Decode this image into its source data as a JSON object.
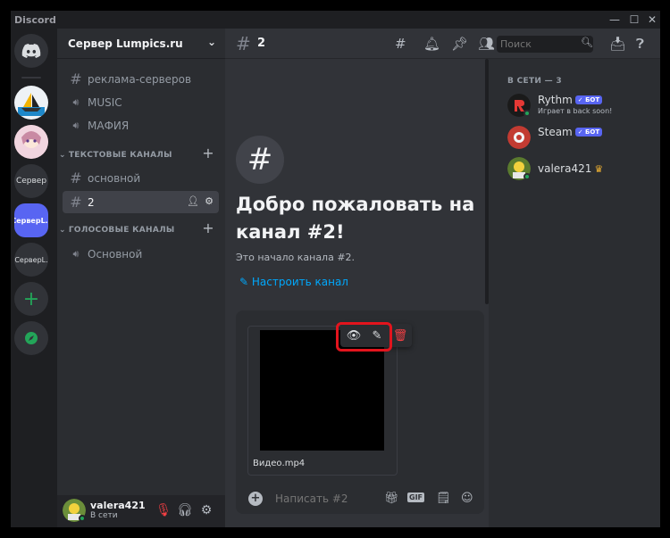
{
  "app": {
    "title": "Discord"
  },
  "window_controls": {
    "minimize": "—",
    "maximize": "☐",
    "close": "✕"
  },
  "servers": [
    {
      "label": "",
      "name": "discord-home"
    },
    {
      "label": "",
      "name": "boat-server"
    },
    {
      "label": "",
      "name": "anime-server"
    },
    {
      "label": "Сервер",
      "name": "server-plain"
    },
    {
      "label": "СерверL.r",
      "name": "server-lumpics-active"
    },
    {
      "label": "СерверL.",
      "name": "server-l"
    },
    {
      "label": "+",
      "name": "add-server"
    },
    {
      "label": "✦",
      "name": "discover"
    }
  ],
  "sidebar": {
    "server_name": "Сервер Lumpics.ru",
    "top_channels": [
      {
        "type": "text",
        "label": "реклама-серверов"
      },
      {
        "type": "voice",
        "label": "MUSIC"
      },
      {
        "type": "voice",
        "label": "МАФИЯ"
      }
    ],
    "text_category": "ТЕКСТОВЫЕ КАНАЛЫ",
    "text_channels": [
      {
        "label": "основной"
      },
      {
        "label": "2"
      }
    ],
    "voice_category": "ГОЛОСОВЫЕ КАНАЛЫ",
    "voice_channels": [
      {
        "label": "Основной"
      }
    ]
  },
  "user_panel": {
    "username": "valera421",
    "status": "В сети"
  },
  "topbar": {
    "channel_name": "2",
    "search_placeholder": "Поиск"
  },
  "welcome": {
    "title": "Добро пожаловать на канал #2!",
    "subtitle": "Это начало канала #2.",
    "setup_link": "Настроить канал"
  },
  "attachment": {
    "file_name": "Видео.mp4"
  },
  "composer": {
    "placeholder": "Написать #2",
    "gif_label": "GIF"
  },
  "members": {
    "category": "В СЕТИ — 3",
    "list": [
      {
        "name": "Rythm",
        "badge": "✓ БОТ",
        "activity": "Играет в back soon!",
        "avatar_color": "#1a1a1a"
      },
      {
        "name": "Steam",
        "badge": "✓ БОТ",
        "activity": "",
        "avatar_color": "#c23b32"
      },
      {
        "name": "valera421",
        "badge": "",
        "activity": "",
        "avatar_color": "#5a7a2e"
      }
    ]
  },
  "colors": {
    "accent": "#5865f2",
    "online": "#23a559",
    "link": "#00a8fc",
    "highlight": "#e3141d"
  }
}
